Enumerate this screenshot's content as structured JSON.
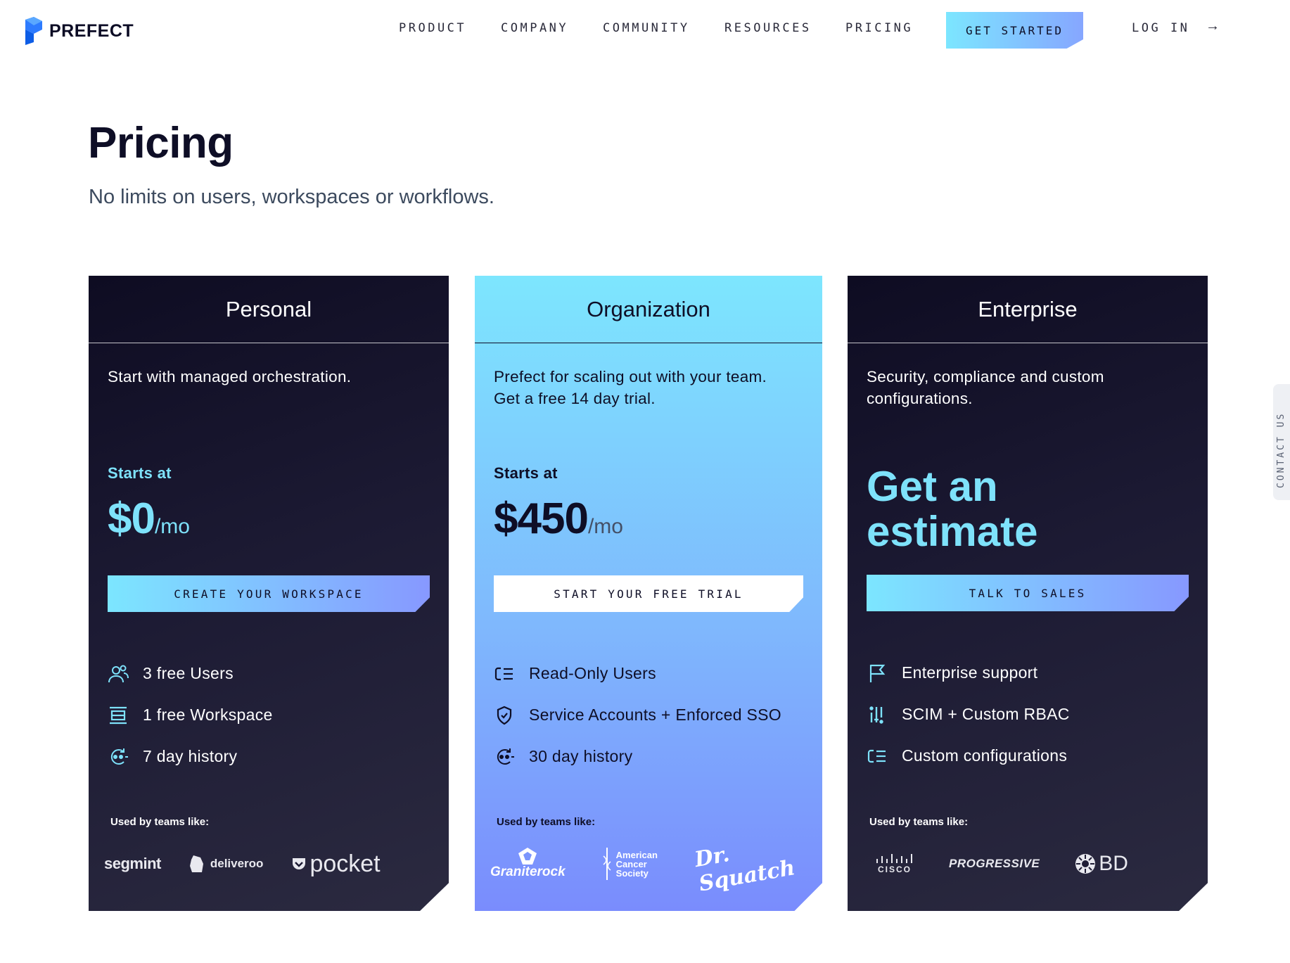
{
  "brand": {
    "name": "PREFECT"
  },
  "nav": {
    "items": [
      "PRODUCT",
      "COMPANY",
      "COMMUNITY",
      "RESOURCES",
      "PRICING"
    ],
    "cta_label": "GET STARTED",
    "login_label": "LOG IN",
    "login_arrow": "→"
  },
  "hero": {
    "title": "Pricing",
    "subtitle": "No limits on users, workspaces or workflows."
  },
  "plans": [
    {
      "name": "Personal",
      "description": "Start with managed orchestration.",
      "starts_label": "Starts at",
      "price": "$0",
      "unit": "/mo",
      "cta": "CREATE YOUR WORKSPACE",
      "features": [
        "3 free Users",
        "1 free Workspace",
        "7 day history"
      ],
      "feature_icons": [
        "users-icon",
        "workspace-icon",
        "history-icon"
      ],
      "used_by_label": "Used by teams like:",
      "logos": [
        "segmint",
        "deliveroo",
        "pocket"
      ]
    },
    {
      "name": "Organization",
      "description": "Prefect for scaling out with your team. Get a free 14 day trial.",
      "starts_label": "Starts at",
      "price": "$450",
      "unit": "/mo",
      "cta": "START YOUR FREE TRIAL",
      "features": [
        "Read-Only Users",
        "Service Accounts + Enforced SSO",
        "30 day history"
      ],
      "feature_icons": [
        "list-icon",
        "shield-icon",
        "history-icon"
      ],
      "used_by_label": "Used by teams like:",
      "logos": [
        "Graniterock",
        "American Cancer Society",
        "Dr. Squatch"
      ]
    },
    {
      "name": "Enterprise",
      "description": "Security, compliance and custom configurations.",
      "estimate_line1": "Get an",
      "estimate_line2": "estimate",
      "cta": "TALK TO SALES",
      "features": [
        "Enterprise support",
        "SCIM + Custom RBAC",
        "Custom configurations"
      ],
      "feature_icons": [
        "flag-icon",
        "rbac-icon",
        "list-icon"
      ],
      "used_by_label": "Used by teams like:",
      "logos": [
        "CISCO",
        "PROGRESSIVE",
        "BD"
      ]
    }
  ],
  "contact_tab": {
    "label": "CONTACT US"
  },
  "colors": {
    "accent_cyan": "#7ee2fb",
    "accent_blue": "#7a8cfd",
    "dark_card": "#1c1a33",
    "text_dark": "#0e0e26"
  }
}
